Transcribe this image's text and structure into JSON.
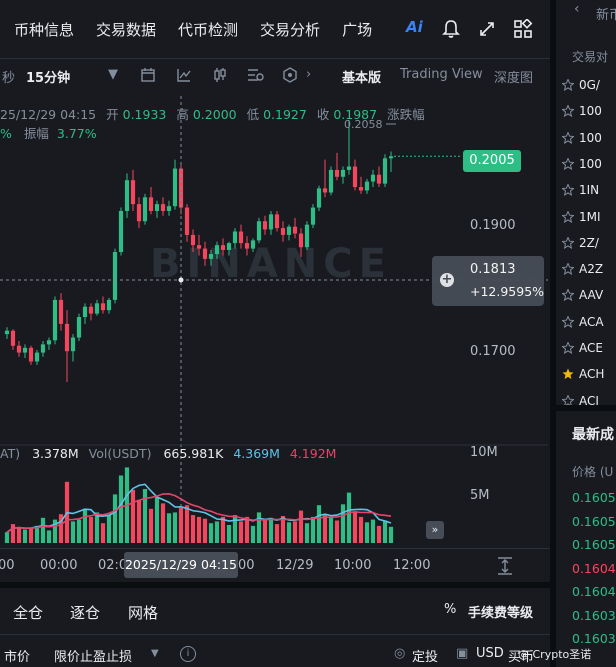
{
  "top_nav": {
    "items": [
      "币种信息",
      "交易数据",
      "代币检测",
      "交易分析",
      "广场"
    ],
    "ai_label": "Ai"
  },
  "toolbar": {
    "seconds_label": "秒",
    "interval": "15分钟",
    "basic_version": "基本版",
    "trading_view": "Trading View",
    "depth_chart": "深度图"
  },
  "ohlc": {
    "datetime": "25/12/29 04:15",
    "open_label": "开",
    "open": "0.1933",
    "high_label": "高",
    "high": "0.2000",
    "low_label": "低",
    "low": "0.1927",
    "close_label": "收",
    "close": "0.1987",
    "change_label": "涨跌幅",
    "change_partial": "%",
    "amplitude_label": "振幅",
    "amplitude": "3.77%"
  },
  "chart_labels": {
    "current_price": "0.2005",
    "high_marker": "0.2058",
    "price_axis": [
      "0.1900",
      "0.1700"
    ],
    "crosshair_price": "0.1813",
    "crosshair_change": "+12.9595%",
    "watermark": "BINANCE"
  },
  "volume": {
    "ma_label": "AT)",
    "ma_value": "3.378M",
    "vol_label": "Vol(USDT)",
    "vol_value": "665.981K",
    "ma5": "4.369M",
    "ma10": "4.192M",
    "axis": [
      "10M",
      "5M"
    ]
  },
  "time_axis": {
    "ticks": [
      "00",
      "00:00",
      "02:0",
      "00",
      "12/29",
      "10:00",
      "12:00"
    ],
    "highlight": "2025/12/29 04:15"
  },
  "bottom_tabs": {
    "cross": "全仓",
    "isolated": "逐仓",
    "grid": "网格",
    "fee_level": "手续费等级",
    "percent_icon_text": "%"
  },
  "bottom_bar": {
    "market": "市价",
    "limit_tp_sl": "限价止盈止损",
    "fixed_invest": "定投",
    "usd": "USD",
    "buy": "买币"
  },
  "right_panel": {
    "header": "新币",
    "pair_label": "交易对",
    "symbols": [
      "0G/",
      "100",
      "100",
      "100",
      "1IN",
      "1MI",
      "2Z/",
      "A2Z",
      "AAV",
      "ACA",
      "ACE",
      "ACH",
      "ACI"
    ],
    "latest_trades": "最新成",
    "price_label": "价格 (U",
    "prices": [
      "0.1605",
      "0.1605",
      "0.1605",
      "0.1604",
      "0.1604",
      "0.1603",
      "0.1603"
    ]
  },
  "footer_watermark": "@ Crypto圣诺",
  "colors": {
    "up": "#2ebd85",
    "down": "#f6465d",
    "ma5": "#5fc4e6",
    "ma10": "#e2466b",
    "background": "#181a20"
  },
  "chart_data": {
    "type": "candlestick",
    "interval": "15m",
    "candles": [
      [
        0.1745,
        0.1755,
        0.1738,
        0.175
      ],
      [
        0.175,
        0.1752,
        0.1722,
        0.1728
      ],
      [
        0.1728,
        0.1735,
        0.1712,
        0.1718
      ],
      [
        0.1718,
        0.173,
        0.171,
        0.1725
      ],
      [
        0.1725,
        0.1728,
        0.17,
        0.1705
      ],
      [
        0.1705,
        0.1722,
        0.17,
        0.1718
      ],
      [
        0.1718,
        0.1735,
        0.1712,
        0.173
      ],
      [
        0.173,
        0.174,
        0.1722,
        0.1736
      ],
      [
        0.1736,
        0.18,
        0.173,
        0.1795
      ],
      [
        0.1795,
        0.1805,
        0.175,
        0.176
      ],
      [
        0.176,
        0.178,
        0.1675,
        0.172
      ],
      [
        0.172,
        0.1745,
        0.1705,
        0.174
      ],
      [
        0.174,
        0.1775,
        0.1735,
        0.177
      ],
      [
        0.177,
        0.179,
        0.176,
        0.1785
      ],
      [
        0.1785,
        0.179,
        0.1765,
        0.1775
      ],
      [
        0.1775,
        0.1795,
        0.1772,
        0.179
      ],
      [
        0.179,
        0.18,
        0.1775,
        0.178
      ],
      [
        0.178,
        0.1798,
        0.1775,
        0.1795
      ],
      [
        0.1795,
        0.187,
        0.179,
        0.1865
      ],
      [
        0.1865,
        0.193,
        0.186,
        0.1925
      ],
      [
        0.1925,
        0.198,
        0.1915,
        0.197
      ],
      [
        0.197,
        0.1985,
        0.1925,
        0.1935
      ],
      [
        0.1935,
        0.1945,
        0.19,
        0.191
      ],
      [
        0.191,
        0.195,
        0.1905,
        0.1945
      ],
      [
        0.1945,
        0.196,
        0.192,
        0.1925
      ],
      [
        0.1925,
        0.194,
        0.1915,
        0.1935
      ],
      [
        0.1935,
        0.1945,
        0.1918,
        0.1925
      ],
      [
        0.1925,
        0.194,
        0.1918,
        0.1932
      ],
      [
        0.1932,
        0.2,
        0.1927,
        0.1987
      ],
      [
        0.1987,
        0.1992,
        0.192,
        0.193
      ],
      [
        0.193,
        0.1935,
        0.188,
        0.189
      ],
      [
        0.189,
        0.1898,
        0.1865,
        0.1875
      ],
      [
        0.1875,
        0.189,
        0.186,
        0.187
      ],
      [
        0.187,
        0.188,
        0.1845,
        0.1855
      ],
      [
        0.1855,
        0.1868,
        0.1845,
        0.1862
      ],
      [
        0.1862,
        0.188,
        0.1855,
        0.1875
      ],
      [
        0.1875,
        0.1885,
        0.186,
        0.1868
      ],
      [
        0.1868,
        0.188,
        0.186,
        0.1878
      ],
      [
        0.1878,
        0.19,
        0.187,
        0.1895
      ],
      [
        0.1895,
        0.1905,
        0.187,
        0.1878
      ],
      [
        0.1878,
        0.1888,
        0.186,
        0.187
      ],
      [
        0.187,
        0.1885,
        0.1865,
        0.1882
      ],
      [
        0.1882,
        0.1915,
        0.1878,
        0.191
      ],
      [
        0.191,
        0.1918,
        0.189,
        0.1898
      ],
      [
        0.1898,
        0.1925,
        0.189,
        0.192
      ],
      [
        0.192,
        0.1925,
        0.1895,
        0.19
      ],
      [
        0.19,
        0.191,
        0.188,
        0.189
      ],
      [
        0.189,
        0.1905,
        0.1882,
        0.1902
      ],
      [
        0.1902,
        0.1915,
        0.1885,
        0.1892
      ],
      [
        0.1892,
        0.19,
        0.1858,
        0.1872
      ],
      [
        0.1872,
        0.191,
        0.1868,
        0.1905
      ],
      [
        0.1905,
        0.1935,
        0.19,
        0.193
      ],
      [
        0.193,
        0.1962,
        0.1925,
        0.1958
      ],
      [
        0.1958,
        0.2,
        0.1945,
        0.1952
      ],
      [
        0.1952,
        0.199,
        0.1948,
        0.1985
      ],
      [
        0.1985,
        0.201,
        0.197,
        0.1975
      ],
      [
        0.1975,
        0.199,
        0.1965,
        0.1985
      ],
      [
        0.1985,
        0.2058,
        0.1978,
        0.199
      ],
      [
        0.199,
        0.2,
        0.1955,
        0.196
      ],
      [
        0.196,
        0.1975,
        0.195,
        0.1955
      ],
      [
        0.1955,
        0.1972,
        0.195,
        0.1968
      ],
      [
        0.1968,
        0.1985,
        0.196,
        0.1978
      ],
      [
        0.1978,
        0.199,
        0.196,
        0.1965
      ],
      [
        0.1965,
        0.2008,
        0.196,
        0.2002
      ],
      [
        0.2002,
        0.2012,
        0.1982,
        0.2005
      ]
    ],
    "volume_millions": [
      1.2,
      2.1,
      1.8,
      1.5,
      1.7,
      1.9,
      2.8,
      1.4,
      2.6,
      3.2,
      6.8,
      2.4,
      2.6,
      3.8,
      2.9,
      3.4,
      2.2,
      3.1,
      5.4,
      7.5,
      8.4,
      5.9,
      4.8,
      6.0,
      3.8,
      5.1,
      4.4,
      3.3,
      3.4,
      3.9,
      4.2,
      3.1,
      2.9,
      2.7,
      2.2,
      2.4,
      2.9,
      2.0,
      3.1,
      2.4,
      2.9,
      1.9,
      3.4,
      2.5,
      2.8,
      2.1,
      3.0,
      2.3,
      2.4,
      3.6,
      2.2,
      2.9,
      4.2,
      3.1,
      2.8,
      2.5,
      4.3,
      5.6,
      3.4,
      2.9,
      2.3,
      2.6,
      1.9,
      2.5,
      1.8
    ],
    "price_axis": [
      0.19,
      0.17
    ],
    "volume_axis": [
      10,
      5
    ],
    "crosshair": {
      "price": 0.1813,
      "time": "2025/12/29 04:15"
    }
  }
}
